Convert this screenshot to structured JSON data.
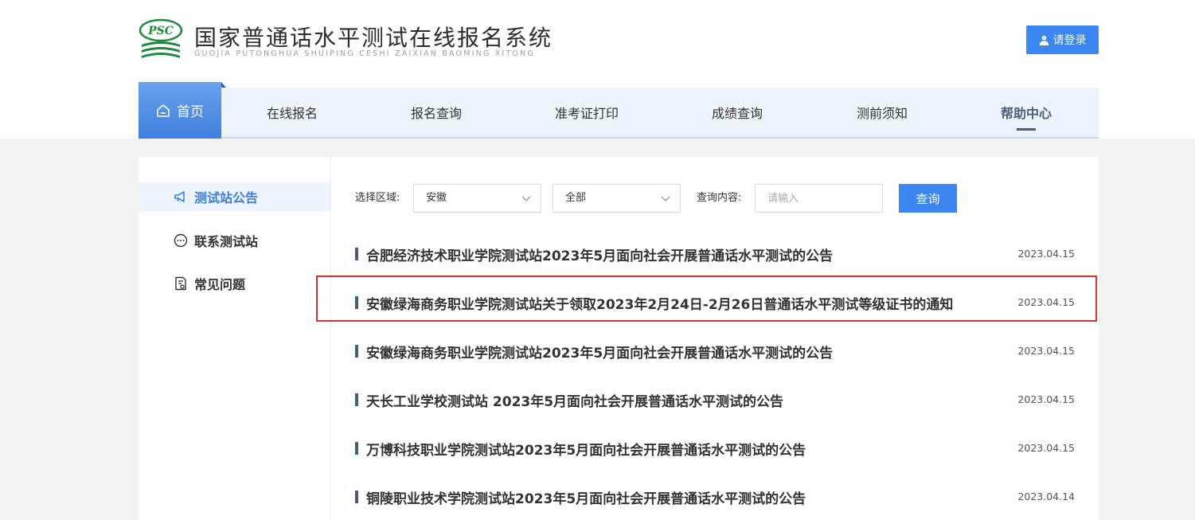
{
  "header": {
    "logo_badge": "PSC",
    "title": "国家普通话水平测试在线报名系统",
    "subtitle": "GUOJIA PUTONGHUA SHUIPING CESHI ZAIXIAN BAOMING XITONG",
    "login_label": "请登录"
  },
  "nav": {
    "home": "首页",
    "items": [
      {
        "label": "在线报名"
      },
      {
        "label": "报名查询"
      },
      {
        "label": "准考证打印"
      },
      {
        "label": "成绩查询"
      },
      {
        "label": "测前须知"
      },
      {
        "label": "帮助中心"
      }
    ]
  },
  "sidebar": {
    "items": [
      {
        "label": "测试站公告",
        "icon": "megaphone-icon"
      },
      {
        "label": "联系测试站",
        "icon": "chat-bubble-icon"
      },
      {
        "label": "常见问题",
        "icon": "document-question-icon"
      }
    ]
  },
  "filters": {
    "region_label": "选择区域:",
    "region_value": "安徽",
    "scope_value": "全部",
    "query_label": "查询内容:",
    "query_placeholder": "请输入",
    "query_button": "查询"
  },
  "notices": [
    {
      "title": "合肥经济技术职业学院测试站2023年5月面向社会开展普通话水平测试的公告",
      "date": "2023.04.15"
    },
    {
      "title": "安徽绿海商务职业学院测试站关于领取2023年2月24日-2月26日普通话水平测试等级证书的通知",
      "date": "2023.04.15"
    },
    {
      "title": "安徽绿海商务职业学院测试站2023年5月面向社会开展普通话水平测试的公告",
      "date": "2023.04.15"
    },
    {
      "title": "天长工业学校测试站 2023年5月面向社会开展普通话水平测试的公告",
      "date": "2023.04.15"
    },
    {
      "title": "万博科技职业学院测试站2023年5月面向社会开展普通话水平测试的公告",
      "date": "2023.04.15"
    },
    {
      "title": "铜陵职业技术学院测试站2023年5月面向社会开展普通话水平测试的公告",
      "date": "2023.04.14"
    }
  ],
  "colors": {
    "primary": "#3b86f1",
    "nav_bg": "#edf3fb",
    "highlight": "#d8343a"
  }
}
